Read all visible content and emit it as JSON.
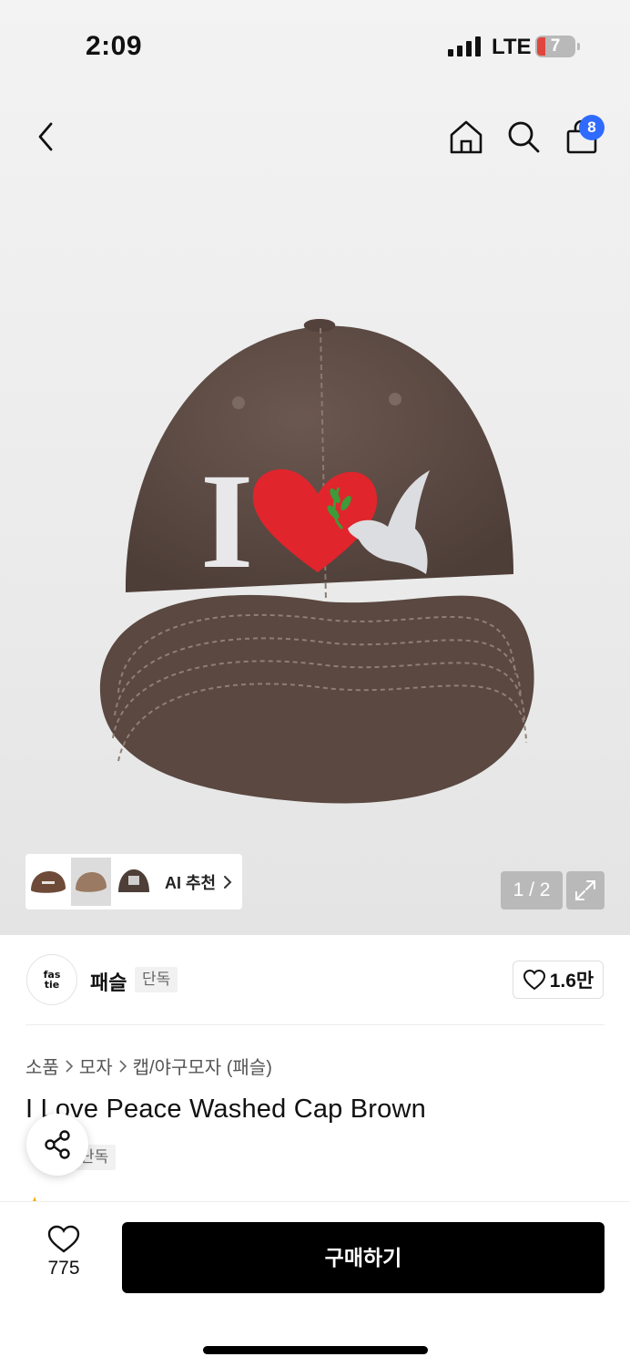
{
  "status_bar": {
    "time": "2:09",
    "network": "LTE",
    "battery": "7"
  },
  "nav": {
    "cart_count": "8",
    "icons": [
      "chevron-left-icon",
      "home-icon",
      "search-icon",
      "shopping-bag-icon"
    ]
  },
  "gallery": {
    "page_indicator": "1 / 2",
    "ai_label": "AI 추천",
    "image_print": {
      "letter": "I"
    }
  },
  "brand": {
    "logo_line1": "fas",
    "logo_line2": "tie",
    "name": "패슬",
    "badge": "단독",
    "likes": "1.6만"
  },
  "breadcrumb": [
    "소품",
    "모자",
    "캡/야구모자 (패슬)"
  ],
  "product": {
    "title": "I Love Peace Washed Cap Brown",
    "badge": "단독"
  },
  "bottom": {
    "wish_count": "775",
    "buy_label": "구매하기"
  },
  "colors": {
    "cart_badge": "#2f6bff",
    "buy_button": "#000000",
    "cap_brown": "#5d4b44",
    "heart_red": "#e0252c"
  }
}
